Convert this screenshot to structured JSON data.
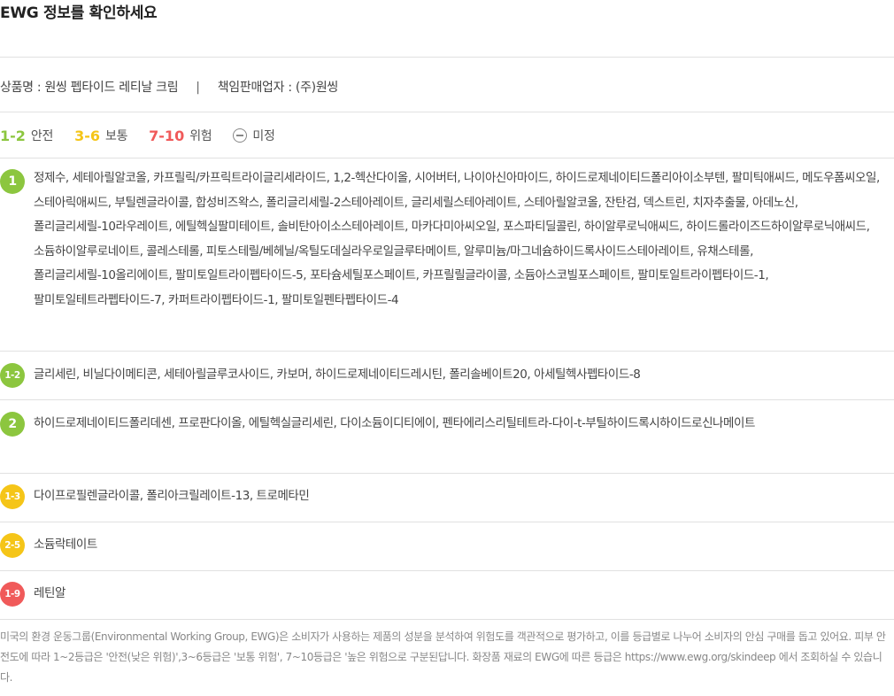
{
  "title": "EWG 정보를 확인하세요",
  "product": {
    "name_text": "상품명 : 원씽 펩타이드 레티날 크림",
    "separator": "|",
    "seller_text": "책임판매업자 : (주)원씽"
  },
  "legend": {
    "safe": {
      "range": "1-2",
      "label": "안전",
      "color": "#8cc63f"
    },
    "moderate": {
      "range": "3-6",
      "label": "보통",
      "color": "#f5c518"
    },
    "hazard": {
      "range": "7-10",
      "label": "위험",
      "color": "#f05a5a"
    },
    "undetermined": {
      "label": "미정",
      "icon": "minus-circle-icon"
    }
  },
  "ingredients": [
    {
      "grade": "1",
      "color": "#8cc63f",
      "text": "정제수, 세테아릴알코올, 카프릴릭/카프릭트라이글리세라이드, 1,2-헥산다이올, 시어버터, 나이아신아마이드, 하이드로제네이티드폴리아이소부텐, 팔미틱애씨드, 메도우폼씨오일, 스테아릭애씨드, 부틸렌글라이콜, 합성비즈왁스, 폴리글리세릴-2스테아레이트, 글리세릴스테아레이트, 스테아릴알코올, 잔탄검, 덱스트린, 치자추출물, 아데노신, 폴리글리세릴-10라우레이트, 에틸헥실팔미테이트, 솔비탄아이소스테아레이트, 마카다미아씨오일, 포스파티딜콜린, 하이알루로닉애씨드, 하이드롤라이즈드하이알루로닉애씨드, 소듐하이알루로네이트, 콜레스테롤, 피토스테릴/베헤닐/옥틸도데실라우로일글루타메이트, 알루미늄/마그네슘하이드록사이드스테아레이트, 유채스테롤, 폴리글리세릴-10올리에이트, 팔미토일트라이펩타이드-5, 포타슘세틸포스페이트, 카프릴릴글라이콜, 소듐아스코빌포스페이트, 팔미토일트라이펩타이드-1, 팔미토일테트라펩타이드-7, 카퍼트라이펩타이드-1, 팔미토일펜타펩타이드-4"
    },
    {
      "grade": "1-2",
      "color": "#8cc63f",
      "text": "글리세린, 비닐다이메티콘, 세테아릴글루코사이드, 카보머, 하이드로제네이티드레시틴, 폴리솔베이트20, 아세틸헥사펩타이드-8"
    },
    {
      "grade": "2",
      "color": "#8cc63f",
      "text": "하이드로제네이티드폴리데센, 프로판다이올, 에틸헥실글리세린, 다이소듐이디티에이, 펜타에리스리틸테트라-다이-t-부틸하이드록시하이드로신나메이트"
    },
    {
      "grade": "1-3",
      "color": "#f5c518",
      "text": "다이프로필렌글라이콜, 폴리아크릴레이트-13, 트로메타민"
    },
    {
      "grade": "2-5",
      "color": "#f5c518",
      "text": "소듐락테이트"
    },
    {
      "grade": "1-9",
      "color": "#f05a5a",
      "text": "레틴알"
    }
  ],
  "footer": {
    "text": "미국의 환경 운동그룹(Environmental Working Group, EWG)은 소비자가 사용하는 제품의 성분을 분석하여 위험도를 객관적으로 평가하고, 이를 등급별로 나누어 소비자의 안심 구매를 돕고 있어요. 피부 안전도에 따라 1~2등급은 '안전(낮은 위험)',3~6등급은 '보통 위험', 7~10등급은 '높은 위험으로 구분된답니다. 화장품 재료의 EWG에 따른 등급은 https://www.ewg.org/skindeep 에서 조회하실 수 있습니다."
  }
}
